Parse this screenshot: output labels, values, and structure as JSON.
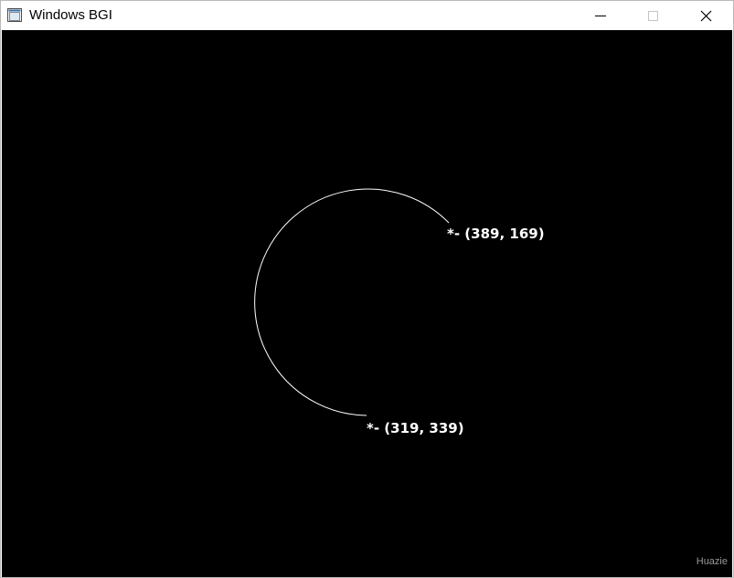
{
  "window": {
    "title": "Windows BGI",
    "icon": "bgi-window-icon",
    "controls": [
      "minimize-icon",
      "maximize-icon",
      "close-icon"
    ]
  },
  "canvas": {
    "background": "#000000",
    "stroke_color": "#ffffff",
    "labels": {
      "start": "*- (389, 169)",
      "end": "*- (319, 339)"
    }
  },
  "watermark": "Huazie"
}
